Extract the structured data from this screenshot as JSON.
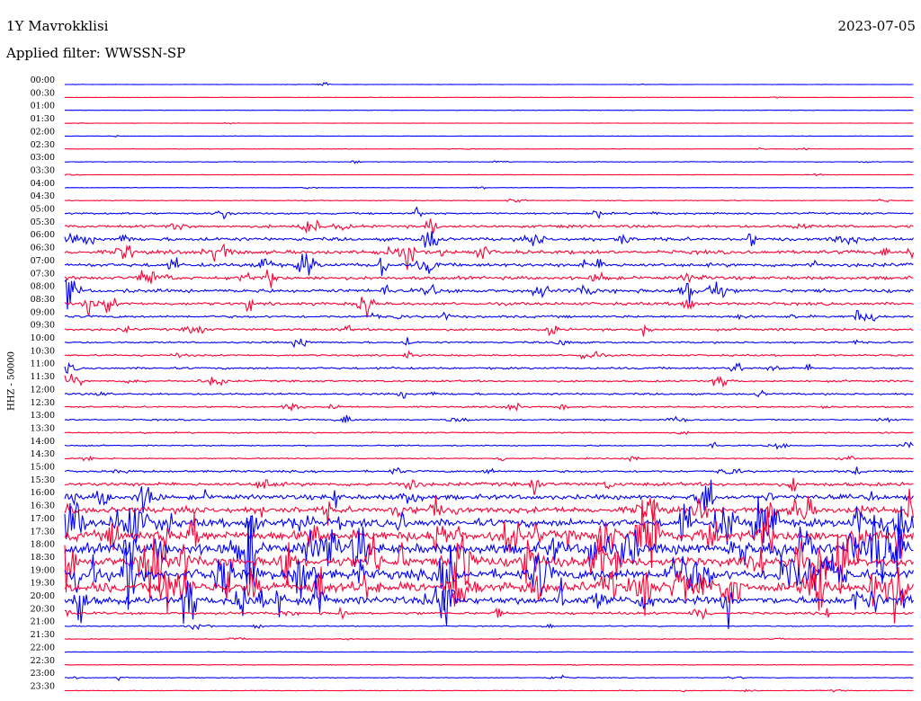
{
  "header": {
    "station": "1Y Mavrokklisi",
    "date": "2023-07-05",
    "filter": "Applied filter: WWSSN-SP"
  },
  "chart_data": {
    "type": "line",
    "title": "1Y Mavrokklisi",
    "subtitle": "Applied filter: WWSSN-SP",
    "ylabel": "HHZ - 50000",
    "colors": [
      "#0000ff",
      "#ff0033"
    ],
    "rows": [
      "00:00",
      "00:30",
      "01:00",
      "01:30",
      "02:00",
      "02:30",
      "03:00",
      "03:30",
      "04:00",
      "04:30",
      "05:00",
      "05:30",
      "06:00",
      "06:30",
      "07:00",
      "07:30",
      "08:00",
      "08:30",
      "09:00",
      "09:30",
      "10:00",
      "10:30",
      "11:00",
      "11:30",
      "12:00",
      "12:30",
      "13:00",
      "13:30",
      "14:00",
      "14:30",
      "15:00",
      "15:30",
      "16:00",
      "16:30",
      "17:00",
      "17:30",
      "18:00",
      "18:30",
      "19:00",
      "19:30",
      "20:00",
      "20:30",
      "21:00",
      "21:30",
      "22:00",
      "22:30",
      "23:00",
      "23:30"
    ],
    "activity": [
      0.25,
      0.25,
      0.25,
      0.25,
      0.25,
      0.25,
      0.4,
      0.3,
      0.3,
      0.5,
      1.2,
      1.8,
      2.2,
      2.4,
      2.4,
      2.2,
      2.4,
      2.0,
      1.6,
      1.6,
      1.2,
      1.2,
      1.4,
      1.3,
      1.3,
      1.0,
      1.0,
      0.8,
      0.8,
      0.8,
      1.4,
      2.4,
      3.2,
      4.0,
      5.2,
      6.5,
      7.0,
      6.5,
      6.8,
      6.5,
      5.0,
      1.6,
      0.7,
      0.5,
      0.4,
      0.4,
      0.5,
      0.4
    ],
    "grid": false
  }
}
